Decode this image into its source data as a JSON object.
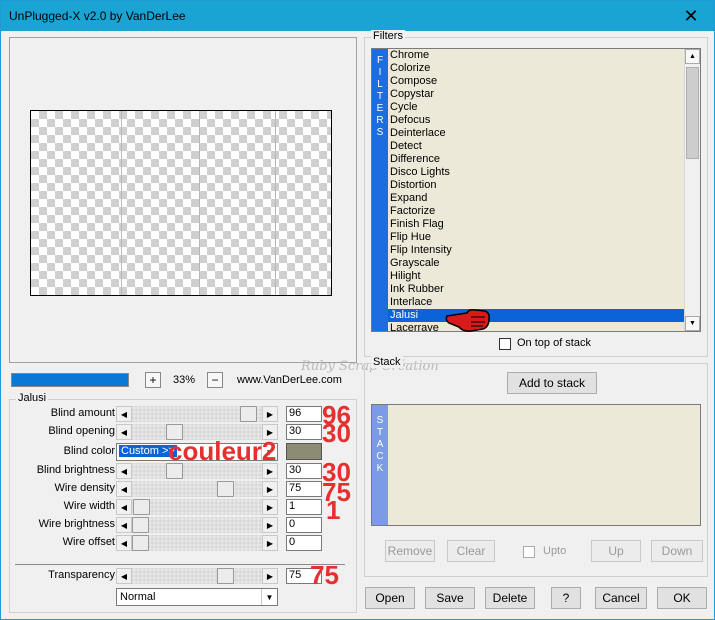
{
  "window": {
    "title": "UnPlugged-X v2.0 by VanDerLee",
    "close_glyph": "✕"
  },
  "preview": {
    "progress_percent": 100,
    "zoom_in": "+",
    "zoom_value": "33%",
    "zoom_out": "−",
    "url": "www.VanDerLee.com"
  },
  "jalusi": {
    "group_title": "Jalusi",
    "params": [
      {
        "label": "Blind amount",
        "value": "96",
        "fraction": 0.96,
        "note": "96"
      },
      {
        "label": "Blind opening",
        "value": "30",
        "fraction": 0.3,
        "note": "30"
      },
      {
        "label": "Blind brightness",
        "value": "30",
        "fraction": 0.3,
        "note": "30"
      },
      {
        "label": "Wire density",
        "value": "75",
        "fraction": 0.75,
        "note": "75"
      },
      {
        "label": "Wire width",
        "value": "1",
        "fraction": 0.01,
        "note": "1"
      },
      {
        "label": "Wire brightness",
        "value": "0",
        "fraction": 0.0,
        "note": ""
      },
      {
        "label": "Wire offset",
        "value": "0",
        "fraction": 0.0,
        "note": ""
      }
    ],
    "blind_color": {
      "label": "Blind color",
      "selected": "Custom >>",
      "swatch": "#8c8c74",
      "note": "couleur2"
    },
    "transparency": {
      "label": "Transparency",
      "value": "75",
      "fraction": 0.75,
      "note": "75"
    },
    "blend_mode": "Normal"
  },
  "filters": {
    "group_title": "Filters",
    "strip_label": "FILTERS",
    "items": [
      "Chrome",
      "Colorize",
      "Compose",
      "Copystar",
      "Cycle",
      "Defocus",
      "Deinterlace",
      "Detect",
      "Difference",
      "Disco Lights",
      "Distortion",
      "Expand",
      "Factorize",
      "Finish Flag",
      "Flip Hue",
      "Flip Intensity",
      "Grayscale",
      "Hilight",
      "Ink Rubber",
      "Interlace",
      "Jalusi",
      "Lacerrave"
    ],
    "selected": "Jalusi",
    "on_top_label": "On top of stack"
  },
  "stack": {
    "group_title": "Stack",
    "add_label": "Add to stack",
    "strip_label": "STACK",
    "remove_label": "Remove",
    "clear_label": "Clear",
    "upto_label": "Upto",
    "up_label": "Up",
    "down_label": "Down"
  },
  "footer": {
    "open": "Open",
    "save": "Save",
    "delete": "Delete",
    "help": "?",
    "cancel": "Cancel",
    "ok": "OK"
  },
  "watermark": "Ruby Scrap Création",
  "colors": {
    "titlebar": "#19a4d3",
    "strip_blue": "#1b6de0",
    "stack_strip": "#7b9be6",
    "selection": "#0a64d8",
    "note_red": "#e53030"
  }
}
